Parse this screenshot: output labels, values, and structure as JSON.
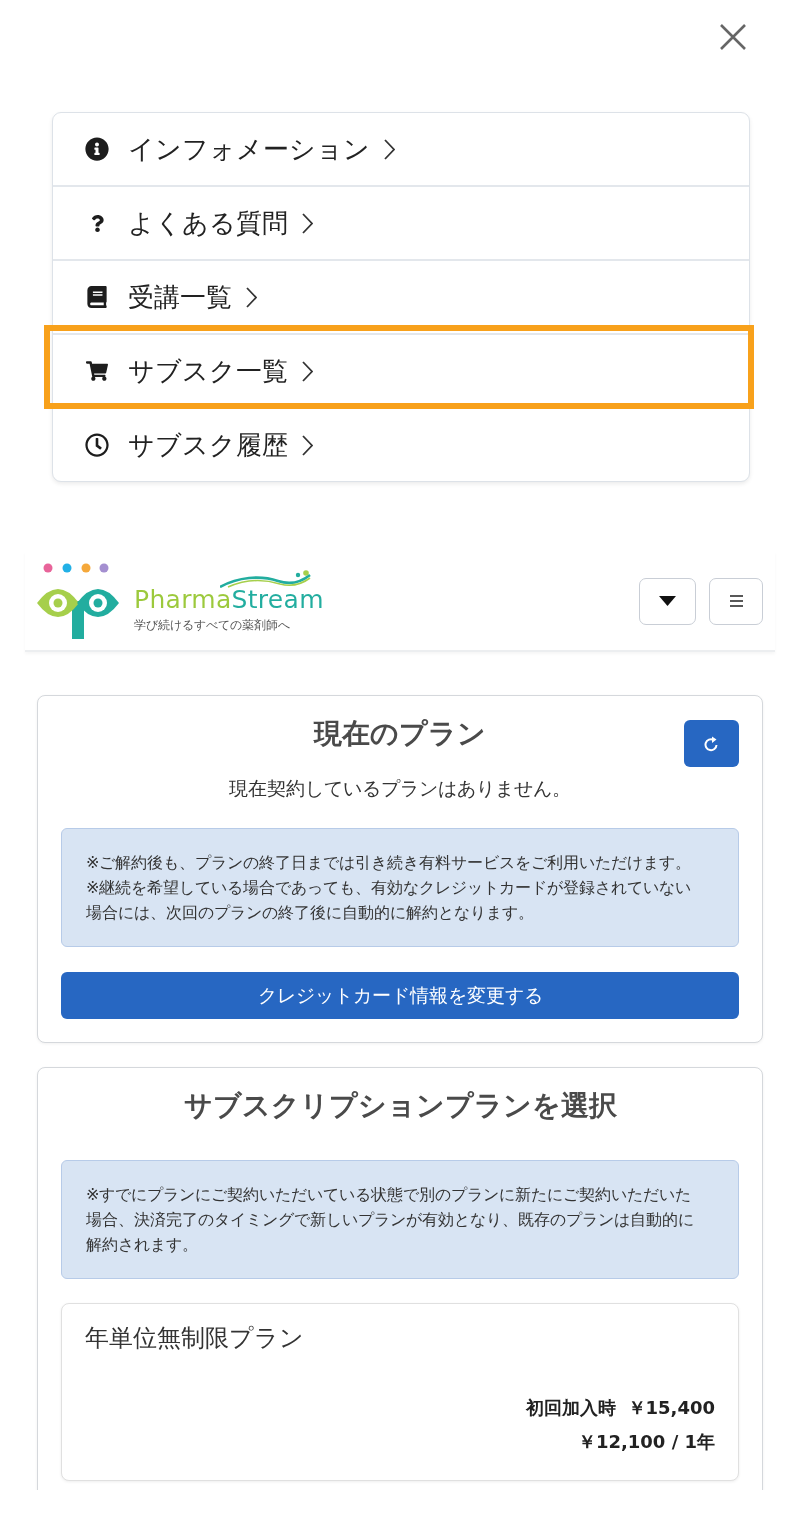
{
  "menu": {
    "items": [
      {
        "kind": "info",
        "label": "インフォメーション",
        "highlighted": false
      },
      {
        "kind": "question",
        "label": "よくある質問",
        "highlighted": false
      },
      {
        "kind": "book",
        "label": "受講一覧",
        "highlighted": false
      },
      {
        "kind": "cart",
        "label": "サブスク一覧",
        "highlighted": true
      },
      {
        "kind": "clock",
        "label": "サブスク履歴",
        "highlighted": false
      }
    ]
  },
  "header": {
    "logo": {
      "name": "PharmaStream",
      "tagline": "学び続けるすべての薬剤師へ"
    }
  },
  "current_plan": {
    "title": "現在のプラン",
    "status": "現在契約しているプランはありません。",
    "notes": [
      "※ご解約後も、プランの終了日までは引き続き有料サービスをご利用いただけます。",
      "※継続を希望している場合であっても、有効なクレジットカードが登録されていない場合には、次回のプランの終了後に自動的に解約となります。"
    ],
    "button": "クレジットカード情報を変更する"
  },
  "plan_selection": {
    "title": "サブスクリプションプランを選択",
    "notes": [
      "※すでにプランにご契約いただいている状態で別のプランに新たにご契約いただいた場合、決済完了のタイミングで新しいプランが有効となり、既存のプランは自動的に解約されます。"
    ],
    "plans": [
      {
        "name": "年単位無制限プラン",
        "prices": [
          {
            "label": "初回加入時",
            "amount": "￥15,400"
          },
          {
            "amount": "￥12,100 / 1年"
          }
        ]
      }
    ]
  }
}
